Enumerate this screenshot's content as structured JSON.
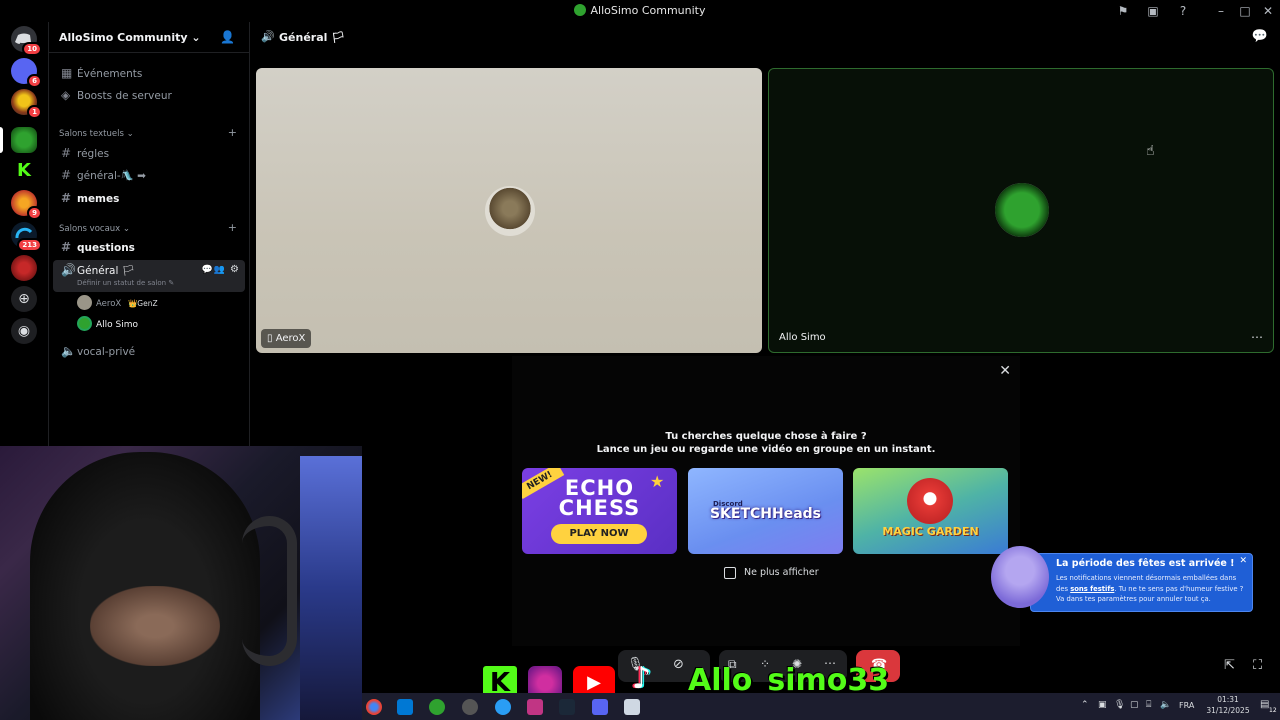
{
  "titlebar": {
    "title": "AlloSimo Community"
  },
  "rail": {
    "badges": [
      "10",
      "6",
      "1",
      "9",
      "213"
    ]
  },
  "sidebar": {
    "server_name": "AlloSimo Community",
    "items": [
      {
        "label": "Événements"
      },
      {
        "label": "Boosts de serveur"
      }
    ],
    "text_category": "Salons textuels",
    "text_channels": [
      {
        "label": "régles"
      },
      {
        "label": "général-🛝 ➡"
      },
      {
        "label": "memes"
      }
    ],
    "voice_category": "Salons vocaux",
    "voice_channels": [
      {
        "label": "questions"
      },
      {
        "label": "Général 🏳"
      },
      {
        "label": "vocal-privé"
      }
    ],
    "status_hint": "Définir un statut de salon",
    "voice_users": [
      {
        "name": "AeroX",
        "tag": "GenZ"
      },
      {
        "name": "Allo Simo"
      }
    ]
  },
  "header": {
    "channel": "Général 🏳"
  },
  "tiles": [
    {
      "name": "AeroX"
    },
    {
      "name": "Allo Simo"
    }
  ],
  "activity": {
    "line1": "Tu cherches quelque chose à faire ?",
    "line2": "Lance un jeu ou regarde une vidéo en groupe en un instant.",
    "games": [
      {
        "title": "ECHO CHESS",
        "badge": "NEW!",
        "cta": "PLAY NOW"
      },
      {
        "title": "SKETCHHeads",
        "brand": "Discord"
      },
      {
        "title": "MAGIC GARDEN"
      }
    ],
    "checkbox_label": "Ne plus afficher"
  },
  "notification": {
    "title": "La période des fêtes est arrivée !",
    "body_1": "Les notifications viennent désormais emballées dans des ",
    "link": "sons festifs",
    "body_2": ". Tu ne te sens pas d'humeur festive ? Va dans tes paramètres pour annuler tout ça."
  },
  "overlay": {
    "handle": "Allo_simo33"
  },
  "taskbar": {
    "lang": "FRA",
    "time": "01:31",
    "date": "31/12/2025",
    "notif_count": "12"
  },
  "colors": {
    "accent_green": "#2fa22f",
    "danger": "#da373c",
    "notif_blue": "#1f5fd6"
  }
}
